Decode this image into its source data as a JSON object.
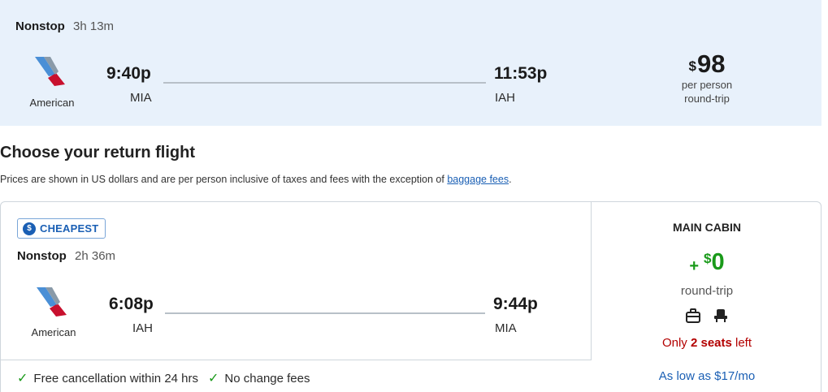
{
  "outbound": {
    "stops": "Nonstop",
    "duration": "3h 13m",
    "airline": "American",
    "depart_time": "9:40p",
    "depart_airport": "MIA",
    "arrive_time": "11:53p",
    "arrive_airport": "IAH",
    "price_currency": "$",
    "price_amount": "98",
    "price_sub1": "per person",
    "price_sub2": "round-trip"
  },
  "section": {
    "title": "Choose your return flight",
    "notice_prefix": "Prices are shown in US dollars and are per person inclusive of taxes and fees with the exception of ",
    "notice_link": "baggage fees",
    "notice_suffix": "."
  },
  "return_flight": {
    "badge": "CHEAPEST",
    "badge_icon": "dollar-badge-icon",
    "stops": "Nonstop",
    "duration": "2h 36m",
    "airline": "American",
    "depart_time": "6:08p",
    "depart_airport": "IAH",
    "arrive_time": "9:44p",
    "arrive_airport": "MIA",
    "perks": [
      "Free cancellation within 24 hrs",
      "No change fees"
    ]
  },
  "fare": {
    "cabin": "MAIN CABIN",
    "plus": "+",
    "currency": "$",
    "amount": "0",
    "trip_type": "round-trip",
    "seats_prefix": "Only ",
    "seats_count": "2 seats",
    "seats_suffix": " left",
    "financing": "As low as $17/mo",
    "amenity_icons": [
      "carry-on-bag-icon",
      "seat-icon"
    ]
  },
  "colors": {
    "outbound_bg": "#e8f1fb",
    "accent_blue": "#1a5fb4",
    "price_green": "#1a9a1a",
    "seats_red": "#b30000",
    "logo_red": "#c8102e",
    "logo_blue": "#4a8fd6"
  }
}
